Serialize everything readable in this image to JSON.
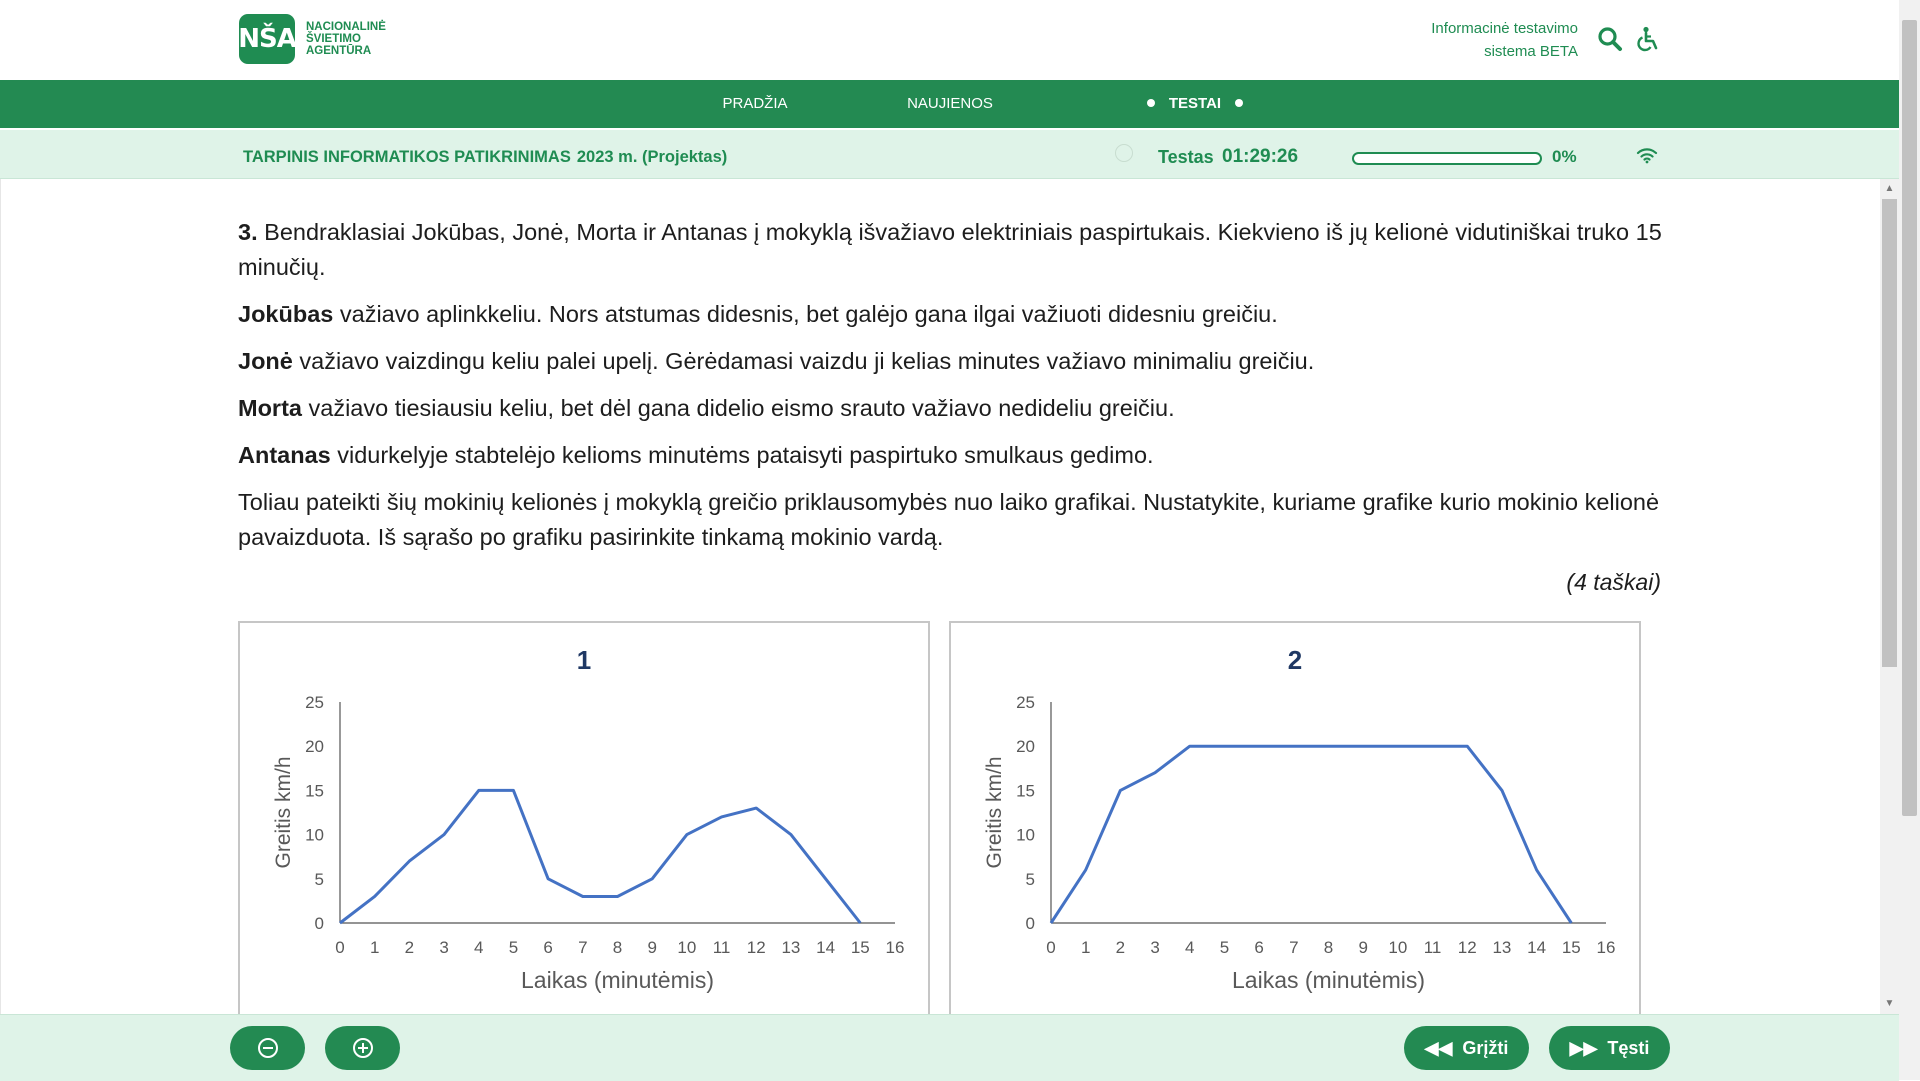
{
  "header": {
    "logo_mark": "NŠA",
    "logo_lines": [
      "NACIONALINĖ",
      "ŠVIETIMO",
      "AGENTŪRA"
    ],
    "system_line1": "Informacinė testavimo",
    "system_line2": "sistema BETA",
    "icons": [
      "search-icon",
      "accessibility-icon"
    ]
  },
  "nav": {
    "items": [
      {
        "label": "PRADŽIA"
      },
      {
        "label": "NAUJIENOS"
      },
      {
        "label": "TESTAI"
      }
    ]
  },
  "exam": {
    "title": "TARPINIS INFORMATIKOS PATIKRINIMAS",
    "year": "2023 m. (Projektas)",
    "timer_label": "Testas",
    "timer_value": "01:29:26",
    "progress_percent": 0,
    "progress_label": "0%"
  },
  "question": {
    "number": "3.",
    "intro": " Bendraklasiai Jokūbas, Jonė, Morta ir Antanas į mokyklą išvažiavo elektriniais paspirtukais. Kiekvieno iš jų kelionė vidutiniškai truko 15 minučių.",
    "students": [
      {
        "name": "Jokūbas",
        "text": " važiavo aplinkkeliu. Nors atstumas didesnis, bet galėjo gana ilgai važiuoti didesniu greičiu."
      },
      {
        "name": "Jonė",
        "text": " važiavo vaizdingu keliu palei upelį. Gėrėdamasi vaizdu ji kelias minutes važiavo minimaliu greičiu."
      },
      {
        "name": "Morta",
        "text": " važiavo tiesiausiu keliu, bet dėl gana didelio eismo srauto važiavo nedideliu greičiu."
      },
      {
        "name": "Antanas",
        "text": " vidurkelyje stabtelėjo kelioms minutėms pataisyti paspirtuko smulkaus gedimo."
      }
    ],
    "instruction": "Toliau pateikti šių mokinių kelionės į mokyklą greičio priklausomybės nuo laiko grafikai. Nustatykite, kuriame grafike kurio mokinio kelionė pavaizduota. Iš sąrašo po grafiku pasirinkite tinkamą mokinio vardą.",
    "points": "(4 taškai)"
  },
  "chart_data": [
    {
      "type": "line",
      "title": "1",
      "xlabel": "Laikas (minutėmis)",
      "ylabel": "Greitis  km/h",
      "x": [
        0,
        1,
        2,
        3,
        4,
        5,
        6,
        7,
        8,
        9,
        10,
        11,
        12,
        13,
        14,
        15
      ],
      "series": [
        {
          "values": [
            0,
            3,
            7,
            10,
            15,
            15,
            5,
            3,
            3,
            5,
            10,
            12,
            13,
            10,
            5,
            0
          ]
        }
      ],
      "xlim": [
        0,
        16
      ],
      "ylim": [
        0,
        25
      ],
      "xticks": [
        0,
        1,
        2,
        3,
        4,
        5,
        6,
        7,
        8,
        9,
        10,
        11,
        12,
        13,
        14,
        15,
        16
      ],
      "yticks": [
        0,
        5,
        10,
        15,
        20,
        25
      ],
      "color": "#4472c4",
      "grid": false
    },
    {
      "type": "line",
      "title": "2",
      "xlabel": "Laikas (minutėmis)",
      "ylabel": "Greitis  km/h",
      "x": [
        0,
        1,
        2,
        3,
        4,
        5,
        6,
        7,
        8,
        9,
        10,
        11,
        12,
        13,
        14,
        15
      ],
      "series": [
        {
          "values": [
            0,
            6,
            15,
            17,
            20,
            20,
            20,
            20,
            20,
            20,
            20,
            20,
            20,
            15,
            6,
            0
          ]
        }
      ],
      "xlim": [
        0,
        16
      ],
      "ylim": [
        0,
        25
      ],
      "xticks": [
        0,
        1,
        2,
        3,
        4,
        5,
        6,
        7,
        8,
        9,
        10,
        11,
        12,
        13,
        14,
        15,
        16
      ],
      "yticks": [
        0,
        5,
        10,
        15,
        20,
        25
      ],
      "color": "#4472c4",
      "grid": false
    }
  ],
  "footer": {
    "zoom_out_icon": "zoom-out-icon",
    "zoom_in_icon": "zoom-in-icon",
    "back_label": "Grįžti",
    "next_label": "Tęsti"
  },
  "colors": {
    "brand_green": "#238a52",
    "light_green": "#dff3e8",
    "line_blue": "#4472c4",
    "chart_title": "#1f3864"
  }
}
